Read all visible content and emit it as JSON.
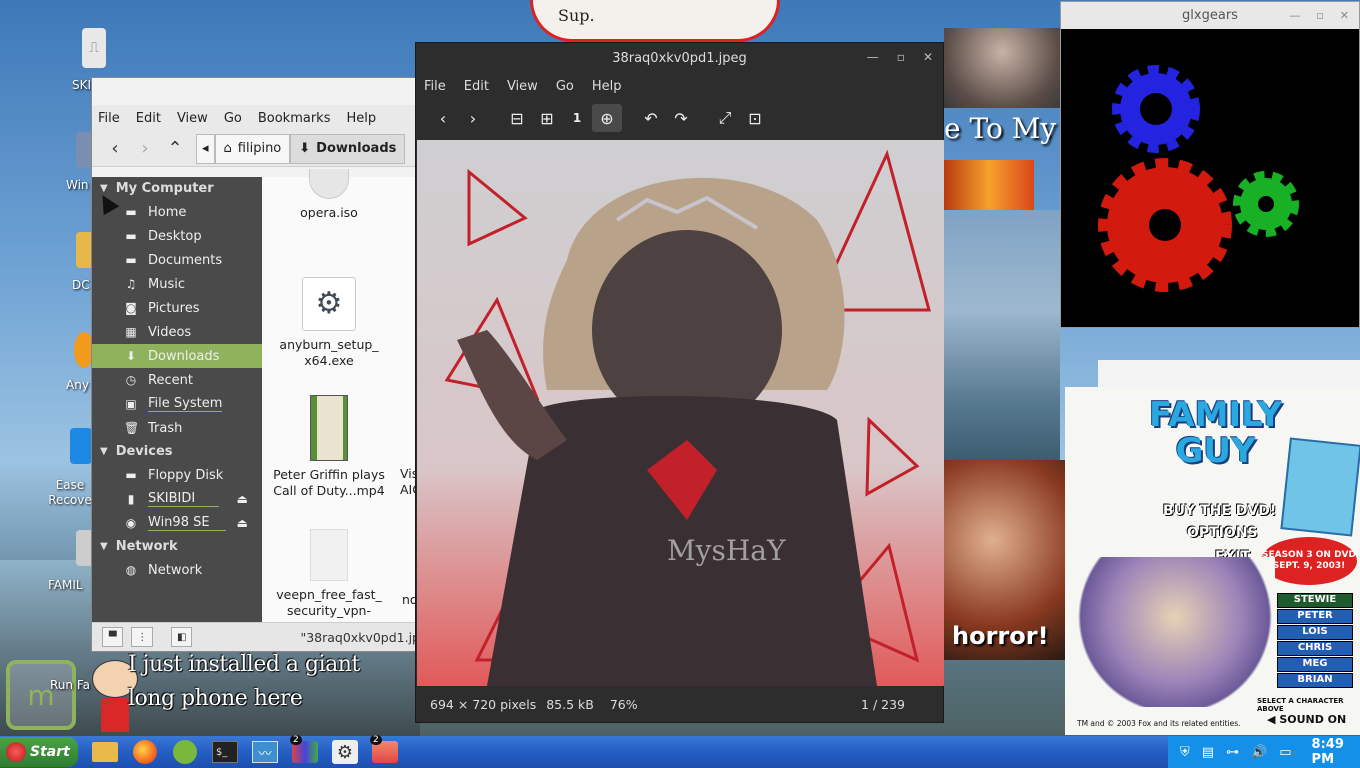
{
  "desktop": {
    "icon_labels": [
      "SKI",
      "Win",
      "DC",
      "Any",
      "Ease\nRecove",
      "FAMIL",
      "Run Fa"
    ],
    "stewie_lines": [
      "I just installed a giant",
      "long phone here"
    ],
    "bg_texts": [
      "Sup.",
      "e To My",
      "horror!"
    ]
  },
  "file_manager": {
    "menu": [
      "File",
      "Edit",
      "View",
      "Go",
      "Bookmarks",
      "Help"
    ],
    "crumbs": [
      "filipino",
      "Downloads"
    ],
    "sections": {
      "my_computer": "My Computer",
      "devices": "Devices",
      "network": "Network"
    },
    "my_computer_items": [
      "Home",
      "Desktop",
      "Documents",
      "Music",
      "Pictures",
      "Videos",
      "Downloads",
      "Recent",
      "File System",
      "Trash"
    ],
    "device_items": [
      "Floppy Disk",
      "SKIBIDI",
      "Win98 SE"
    ],
    "network_items": [
      "Network"
    ],
    "files": [
      {
        "name": "opera.iso"
      },
      {
        "name": "anyburn_setup_\nx64.exe"
      },
      {
        "name": "Peter Griffin plays\nCall of Duty...mp4"
      },
      {
        "name": "veepn_free_fast_\nsecurity_vpn-"
      }
    ],
    "peek": [
      "Vis",
      "AIC",
      "no"
    ],
    "status": "\"38raq0xkv0pd1.jp"
  },
  "viewer": {
    "title": "38raq0xkv0pd1.jpeg",
    "menu": [
      "File",
      "Edit",
      "View",
      "Go",
      "Help"
    ],
    "status_dims": "694 × 720 pixels",
    "status_size": "85.5 kB",
    "status_zoom": "76%",
    "status_page": "1 / 239",
    "signature": "MysHaY"
  },
  "glxgears": {
    "title": "glxgears"
  },
  "family_guy": {
    "logo_line1": "FAMILY",
    "logo_line2": "GUY",
    "buy": "BUY THE DVD!",
    "options": "OPTIONS",
    "exit": "EXIT",
    "season": "SEASON 3 ON DVD\nSEPT. 9, 2003!",
    "characters": [
      "STEWIE",
      "PETER",
      "LOIS",
      "CHRIS",
      "MEG",
      "BRIAN"
    ],
    "select": "SELECT A CHARACTER ABOVE",
    "copyright": "TM and © 2003 Fox and its related entities.",
    "sound": "SOUND ON"
  },
  "taskbar": {
    "start": "Start",
    "badges": [
      "2",
      "2"
    ],
    "clock": "8:49 PM"
  },
  "colors": {
    "accent_green": "#8fb35c",
    "taskbar_blue": "#245ec4",
    "tray_blue": "#1590e8"
  }
}
